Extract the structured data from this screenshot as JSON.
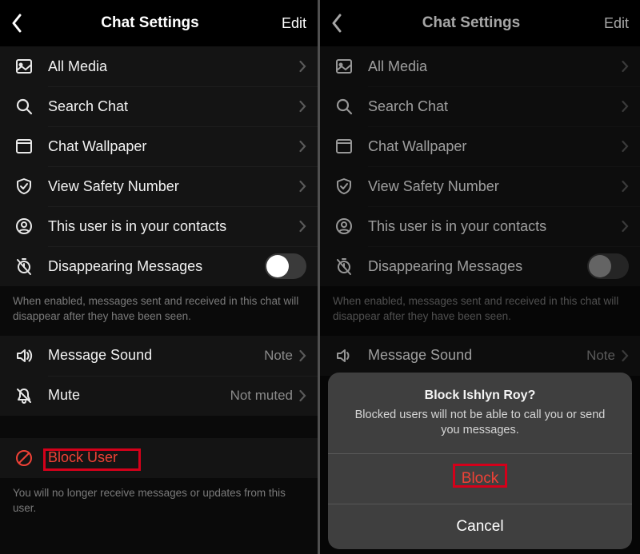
{
  "colors": {
    "danger": "#ef4136",
    "highlight": "#d4001a"
  },
  "left": {
    "title": "Chat Settings",
    "edit": "Edit",
    "rows": {
      "allMedia": "All Media",
      "searchChat": "Search Chat",
      "chatWallpaper": "Chat Wallpaper",
      "viewSafety": "View Safety Number",
      "contacts": "This user is in your contacts",
      "disappearing": "Disappearing Messages",
      "messageSound": "Message Sound",
      "messageSoundValue": "Note",
      "mute": "Mute",
      "muteValue": "Not muted",
      "blockUser": "Block User"
    },
    "disappearingFooter": "When enabled, messages sent and received in this chat will disappear after they have been seen.",
    "blockFooter": "You will no longer receive messages or updates from this user."
  },
  "right": {
    "title": "Chat Settings",
    "edit": "Edit",
    "sheet": {
      "title": "Block Ishlyn Roy?",
      "message": "Blocked users will not be able to call you or send you messages.",
      "block": "Block",
      "cancel": "Cancel"
    }
  }
}
